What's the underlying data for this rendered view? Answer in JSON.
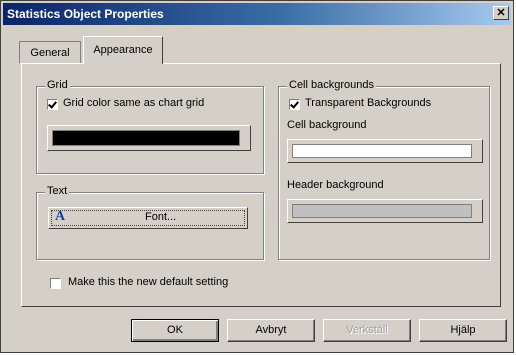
{
  "window": {
    "title": "Statistics Object Properties",
    "close_glyph": "✕"
  },
  "tabs": [
    {
      "label": "General"
    },
    {
      "label": "Appearance"
    }
  ],
  "grid_group": {
    "legend": "Grid",
    "checkbox_label": "Grid color same as chart grid",
    "checkbox_checked": true,
    "color": "#000000"
  },
  "text_group": {
    "legend": "Text",
    "font_button_label": "Font...",
    "font_icon": "A"
  },
  "cell_group": {
    "legend": "Cell backgrounds",
    "transparent_label": "Transparent Backgrounds",
    "transparent_checked": true,
    "cell_bg_label": "Cell background",
    "cell_bg_color": "#ffffff",
    "header_bg_label": "Header background",
    "header_bg_color": "#c0c0c0"
  },
  "default_setting": {
    "label": "Make this the new default setting",
    "checked": false
  },
  "buttons": {
    "ok": "OK",
    "cancel": "Avbryt",
    "apply": "Verkställ",
    "help": "Hjälp"
  }
}
